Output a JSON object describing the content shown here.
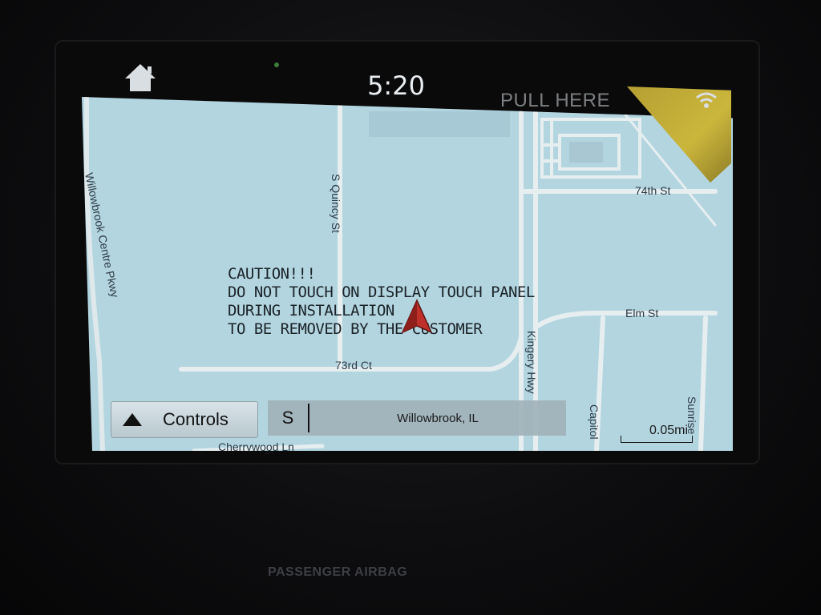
{
  "status_bar": {
    "time": "5:20",
    "icons": [
      "home-icon",
      "wifi-icon"
    ]
  },
  "map": {
    "road_labels": {
      "willowbrook_centre": "Willowbrook Centre Pkwy",
      "quincy": "S Quincy St",
      "seventy_third": "73rd Ct",
      "seventy_fourth": "74th St",
      "elm": "Elm St",
      "kingery": "Kingery Hwy",
      "capitol": "Capitol",
      "sunrise": "Sunrise",
      "cherrywood": "Cherrywood Ln"
    },
    "colors": {
      "land": "#b3d5e0",
      "road": "#e6eef0",
      "road_edge": "#a4c0c9",
      "vehicle": "#c0302b"
    }
  },
  "overlay_notice": {
    "lines": [
      "CAUTION!!!",
      "DO NOT TOUCH ON DISPLAY TOUCH PANEL",
      "DURING INSTALLATION",
      "TO BE REMOVED BY THE CUSTOMER"
    ]
  },
  "controls": {
    "controls_label": "Controls",
    "heading": "S",
    "location": "Willowbrook, IL",
    "scale": "0.05mi"
  },
  "film_tab": {
    "label": "PULL HERE",
    "color": "#cbb63c"
  },
  "dash": {
    "airbag_label": "PASSENGER AIRBAG"
  }
}
